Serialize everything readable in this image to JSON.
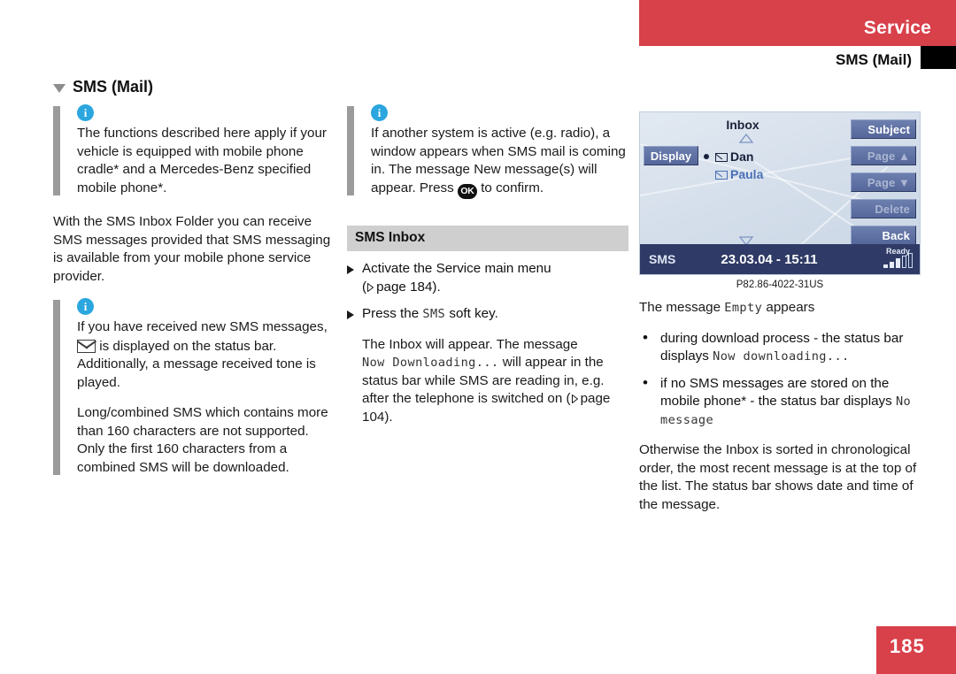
{
  "header": {
    "service_label": "Service",
    "subtitle": "SMS (Mail)"
  },
  "section": {
    "title": "SMS (Mail)"
  },
  "left_column": {
    "note1": "The functions described here apply if your vehicle is equipped with mobile phone cradle* and a Mercedes-Benz specified mobile phone*.",
    "body1": "With the SMS Inbox Folder you can receive SMS messages provided that SMS messaging is available from your mobile phone service provider.",
    "note2_part1": "If you have received new SMS messages,",
    "note2_part2": "is displayed on the status bar. Additionally, a message received tone is played.",
    "note2_para2": "Long/combined SMS which contains more than 160 characters are not supported. Only the first 160 characters from a combined SMS will be downloaded."
  },
  "mid_column": {
    "note1_part1": "If another system is active (e.g. radio), a window appears when SMS mail is coming in. The message New message(s) will appear. Press",
    "note1_part2": "to confirm.",
    "ok_key_label": "OK",
    "sub_head": "SMS Inbox",
    "step1_text": "Activate the Service main menu",
    "step1_ref_open": "(",
    "step1_ref_word": "page 184).",
    "step2_pre": "Press the",
    "step2_mono": "SMS",
    "step2_post": "soft key.",
    "result_pre": "The Inbox will appear. The message",
    "result_mono": "Now Downloading...",
    "result_mid": "will appear in the status bar while SMS are reading in, e.g. after the telephone is switched on (",
    "result_ref": "page 104)."
  },
  "screen": {
    "title": "Inbox",
    "display_key": "Display",
    "softkeys": [
      {
        "label": "Subject",
        "enabled": true
      },
      {
        "label": "Page ▲",
        "enabled": false
      },
      {
        "label": "Page ▼",
        "enabled": false
      },
      {
        "label": "Delete",
        "enabled": false
      },
      {
        "label": "Back",
        "enabled": true
      }
    ],
    "messages": [
      {
        "name": "Dan",
        "selected": true
      },
      {
        "name": "Paula",
        "selected": false
      }
    ],
    "status_left": "SMS",
    "status_center": "23.03.04 - 15:11",
    "status_ready": "Ready"
  },
  "figure_caption": "P82.86-4022-31US",
  "right_column": {
    "intro_pre": "The message",
    "intro_mono": "Empty",
    "intro_post": "appears",
    "bullet1_pre": "during download process - the status bar displays",
    "bullet1_mono": "Now downloading...",
    "bullet2_pre": "if no SMS messages are stored on the mobile phone* - the status bar displays",
    "bullet2_mono": "No message",
    "closing": "Otherwise the Inbox is sorted in chronological order, the most recent message is at the top of the list. The status bar shows date and time of the message."
  },
  "footer": {
    "page_number": "185"
  },
  "colors": {
    "brand_red": "#d8404a",
    "info_blue": "#2ba6de",
    "rule_grey": "#9b9b9b",
    "subhead_grey": "#cfcfcf",
    "screen_status": "#2f3b66"
  }
}
